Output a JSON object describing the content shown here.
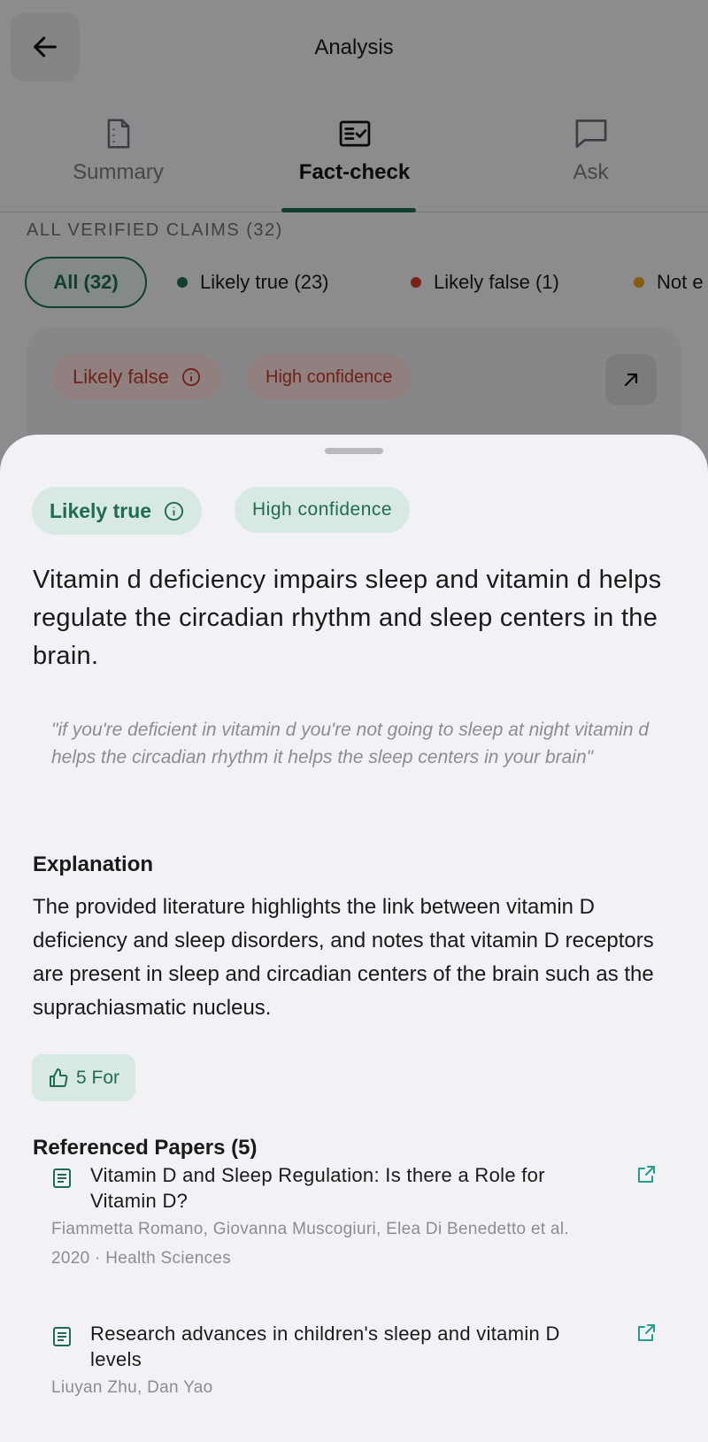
{
  "header": {
    "title": "Analysis"
  },
  "tabs": [
    {
      "label": "Summary",
      "icon": "document-icon",
      "active": false
    },
    {
      "label": "Fact-check",
      "icon": "checklist-icon",
      "active": true
    },
    {
      "label": "Ask",
      "icon": "chat-bubble-icon",
      "active": false
    }
  ],
  "claims_section": {
    "label": "ALL VERIFIED CLAIMS (32)"
  },
  "filters": {
    "all": "All (32)",
    "likely_true": "Likely true (23)",
    "likely_false": "Likely false (1)",
    "not_enough": "Not e"
  },
  "background_card": {
    "verdict": "Likely false",
    "confidence": "High confidence"
  },
  "sheet": {
    "verdict": "Likely true",
    "confidence": "High confidence",
    "claim": "Vitamin d deficiency impairs sleep and vitamin d helps regulate the circadian rhythm and sleep centers in the brain.",
    "quote": "\"if you're deficient in vitamin d you're not going to sleep at night vitamin d helps the circadian rhythm it helps the sleep centers in your brain\"",
    "explanation_title": "Explanation",
    "explanation": "The provided literature highlights the link between vitamin D deficiency and sleep disorders, and notes that vitamin D receptors are present in sleep and circadian centers of the brain such as the suprachiasmatic nucleus.",
    "for_count": "5 For",
    "references_title": "Referenced Papers (5)",
    "papers": [
      {
        "title": "Vitamin D and Sleep Regulation: Is there a Role for Vitamin D?",
        "authors": "Fiammetta Romano, Giovanna Muscogiuri, Elea Di Benedetto et al.",
        "meta": "2020 · Health Sciences"
      },
      {
        "title": "Research advances in children's sleep and vitamin D levels",
        "authors": "Liuyan Zhu, Dan Yao",
        "meta": ""
      }
    ]
  },
  "colors": {
    "accent_green": "#1f6b55",
    "green_tint": "#d8e9e3",
    "dot_true": "#1f6b55",
    "dot_false": "#d33a2c",
    "dot_unknown": "#e0a020",
    "false_text": "#c0392b"
  }
}
